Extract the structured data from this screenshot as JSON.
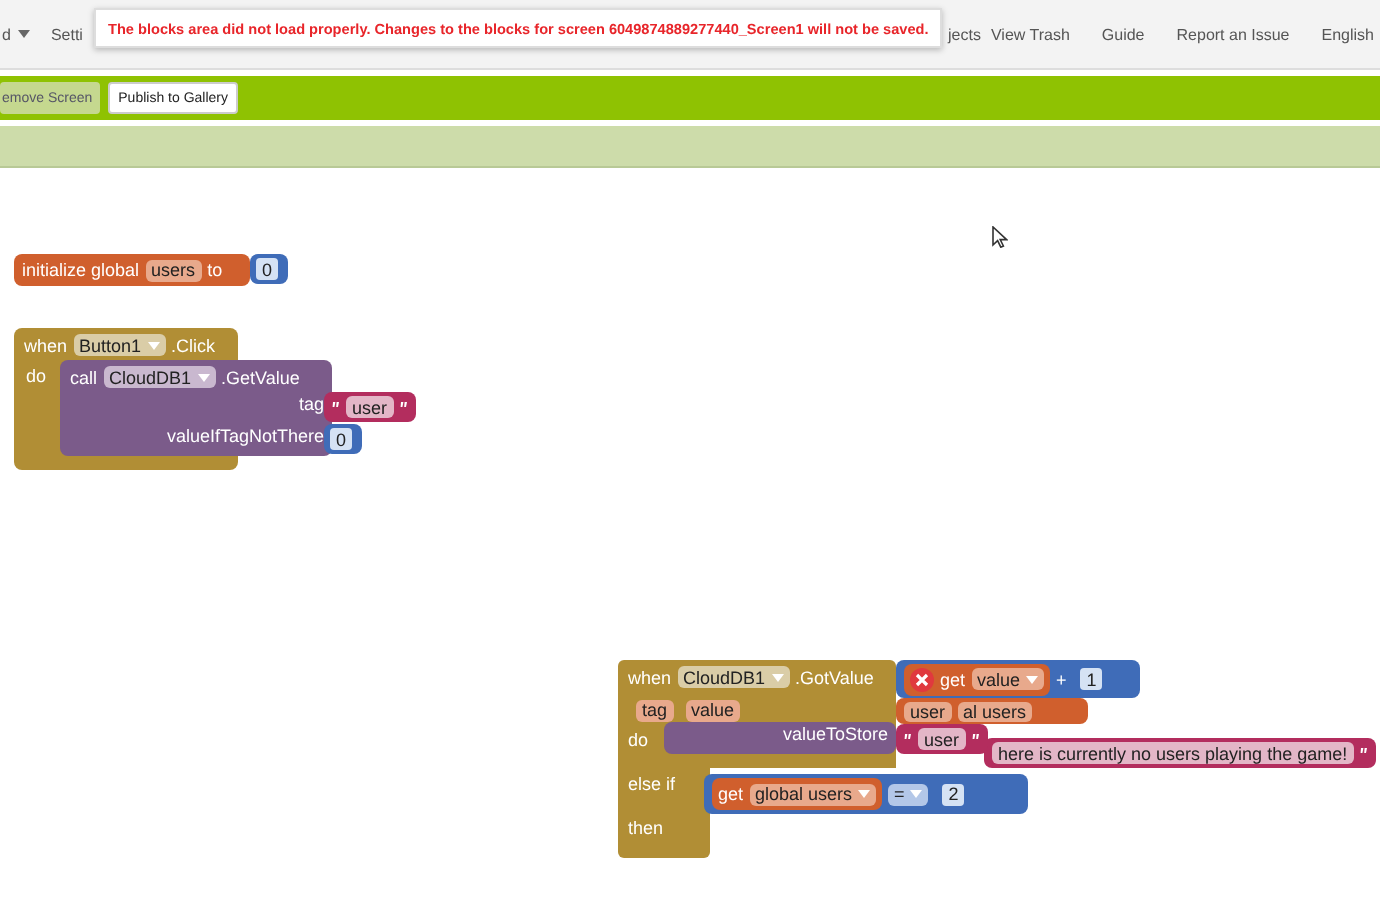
{
  "nav": {
    "items": [
      {
        "label": "d",
        "dropdown": true
      },
      {
        "label": "Setti",
        "dropdown": false
      },
      {
        "label": "jects",
        "dropdown": false
      },
      {
        "label": "View Trash",
        "dropdown": false
      },
      {
        "label": "Guide",
        "dropdown": false
      },
      {
        "label": "Report an Issue",
        "dropdown": false
      },
      {
        "label": "English",
        "dropdown": false
      }
    ]
  },
  "toast": {
    "text": "The blocks area did not load properly. Changes to the blocks for screen 6049874889277440_Screen1 will not be saved."
  },
  "toolbar": {
    "buttons": [
      {
        "label": "emove Screen",
        "kind": "secondary"
      },
      {
        "label": "Publish to Gallery",
        "kind": "primary"
      }
    ]
  },
  "workspace": {
    "init_global": {
      "label": "initialize global",
      "name": "users",
      "to": "to",
      "value": "0"
    },
    "button_click": {
      "when": "when",
      "component": "Button1",
      "event": ".Click",
      "do": "do",
      "call": "call",
      "call_component": "CloudDB1",
      "method": ".GetValue",
      "tag_label": "tag",
      "tag_value": "user",
      "default_label": "valueIfTagNotThere",
      "default_value": "0"
    },
    "stray": {
      "math": {
        "get": "get",
        "variable": "value",
        "operator": "+",
        "operand": "1",
        "error": true
      },
      "fragments": [
        "user",
        "al users"
      ],
      "message": "here is currently no users playing the game!"
    },
    "got_value": {
      "when": "when",
      "component": "CloudDB1",
      "event": ".GotValue",
      "params": [
        "tag",
        "value"
      ],
      "do": "do",
      "store_label": "valueToStore",
      "store_value": "user",
      "else_if": "else if",
      "then": "then",
      "compare": {
        "get": "get",
        "variable": "global users",
        "operator": "=",
        "operand": "2"
      }
    }
  }
}
